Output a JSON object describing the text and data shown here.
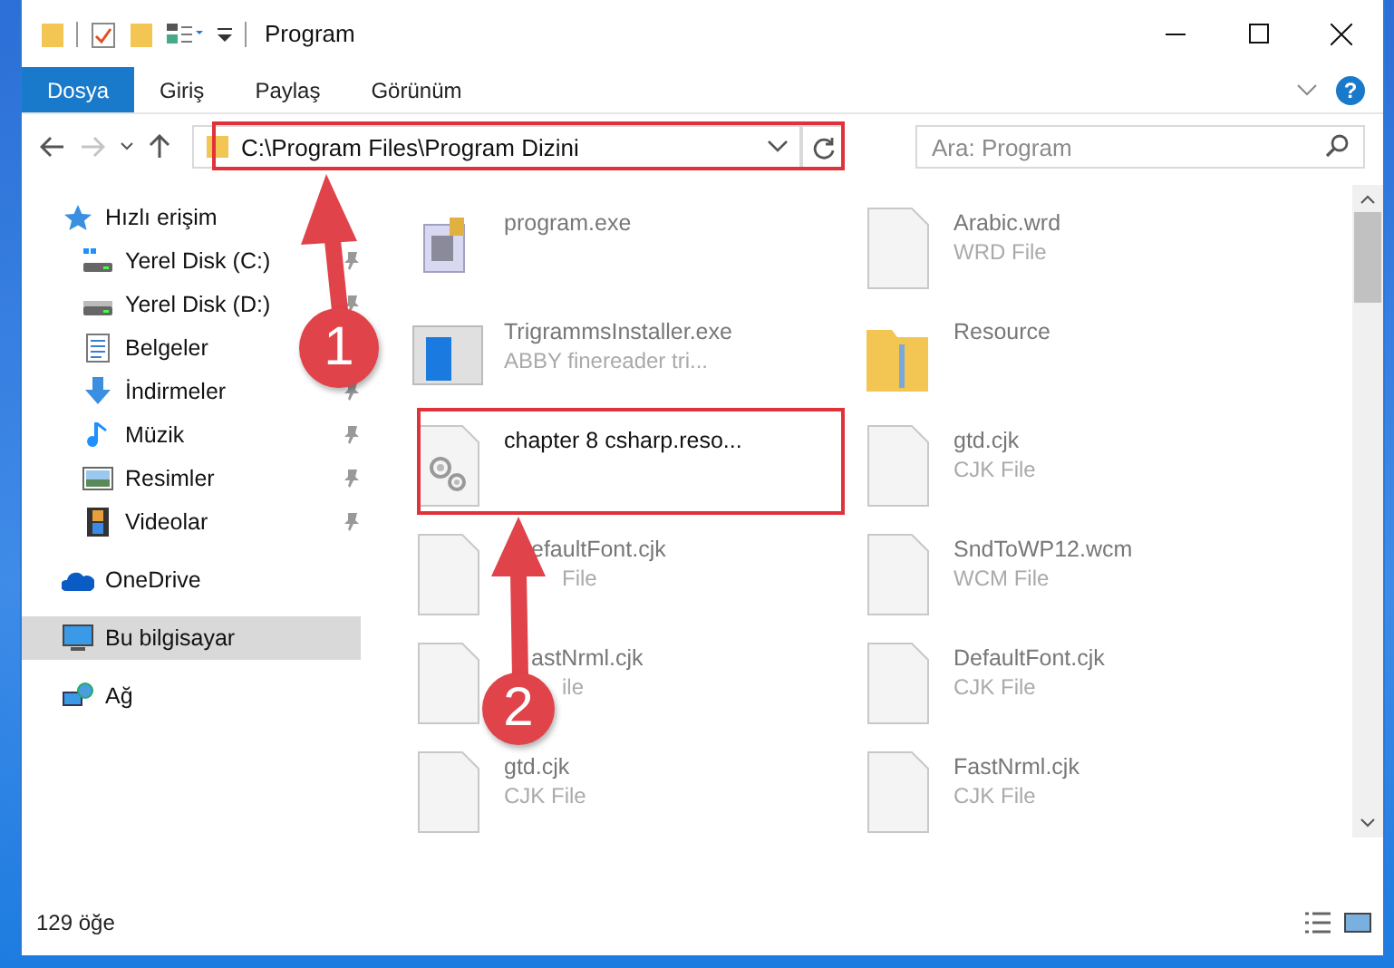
{
  "window": {
    "title": "Program"
  },
  "ribbon": {
    "tabs": [
      {
        "label": "Dosya",
        "selected": true
      },
      {
        "label": "Giriş",
        "selected": false
      },
      {
        "label": "Paylaş",
        "selected": false
      },
      {
        "label": "Görünüm",
        "selected": false
      }
    ],
    "help_label": "?"
  },
  "address_bar": {
    "path": "C:\\Program Files\\Program Dizini",
    "search_placeholder": "Ara: Program"
  },
  "sidebar": {
    "items": [
      {
        "label": "Hızlı erişim",
        "kind": "star",
        "pinned": false,
        "selected": false,
        "section": true
      },
      {
        "label": "Yerel Disk (C:)",
        "kind": "disk_c",
        "pinned": true,
        "selected": false,
        "section": false
      },
      {
        "label": "Yerel Disk (D:)",
        "kind": "disk",
        "pinned": true,
        "selected": false,
        "section": false
      },
      {
        "label": "Belgeler",
        "kind": "document",
        "pinned": false,
        "selected": false,
        "section": false
      },
      {
        "label": "İndirmeler",
        "kind": "download",
        "pinned": true,
        "selected": false,
        "section": false
      },
      {
        "label": "Müzik",
        "kind": "music",
        "pinned": true,
        "selected": false,
        "section": false
      },
      {
        "label": "Resimler",
        "kind": "image",
        "pinned": true,
        "selected": false,
        "section": false
      },
      {
        "label": "Videolar",
        "kind": "film",
        "pinned": true,
        "selected": false,
        "section": false
      },
      {
        "label": "OneDrive",
        "kind": "cloud",
        "pinned": false,
        "selected": false,
        "section": true
      },
      {
        "label": "Bu bilgisayar",
        "kind": "computer",
        "pinned": false,
        "selected": true,
        "section": true
      },
      {
        "label": "Ağ",
        "kind": "network",
        "pinned": false,
        "selected": false,
        "section": true
      }
    ]
  },
  "files": [
    {
      "name": "program.exe",
      "kind": "program",
      "blurred": true
    },
    {
      "name": "Arabic.wrd",
      "type": "WRD File",
      "kind": "document",
      "blurred": true
    },
    {
      "name": "TrigrammsInstaller.exe",
      "type": "ABBY finereader tri...",
      "kind": "installer",
      "blurred": true
    },
    {
      "name": "Resource",
      "kind": "folder",
      "blurred": true
    },
    {
      "name": "chapter 8 csharp.reso...",
      "kind": "settings",
      "blurred": false
    },
    {
      "name": "gtd.cjk",
      "type": "CJK File",
      "kind": "document",
      "blurred": true
    },
    {
      "name": "efaultFont.cjk",
      "type": "File",
      "kind": "document",
      "blurred": true,
      "hidden_start": true
    },
    {
      "name": "SndToWP12.wcm",
      "type": "WCM File",
      "kind": "document",
      "blurred": true
    },
    {
      "name": "astNrml.cjk",
      "type": "ile",
      "kind": "document",
      "blurred": true,
      "hidden_start": true
    },
    {
      "name": "DefaultFont.cjk",
      "type": "CJK File",
      "kind": "document",
      "blurred": true
    },
    {
      "name": "gtd.cjk",
      "type": "CJK File",
      "kind": "document",
      "blurred": true
    },
    {
      "name": "FastNrml.cjk",
      "type": "CJK File",
      "kind": "document",
      "blurred": true
    }
  ],
  "status_bar": {
    "count": "129 öğe"
  },
  "annotations": [
    {
      "label": "1"
    },
    {
      "label": "2"
    }
  ]
}
